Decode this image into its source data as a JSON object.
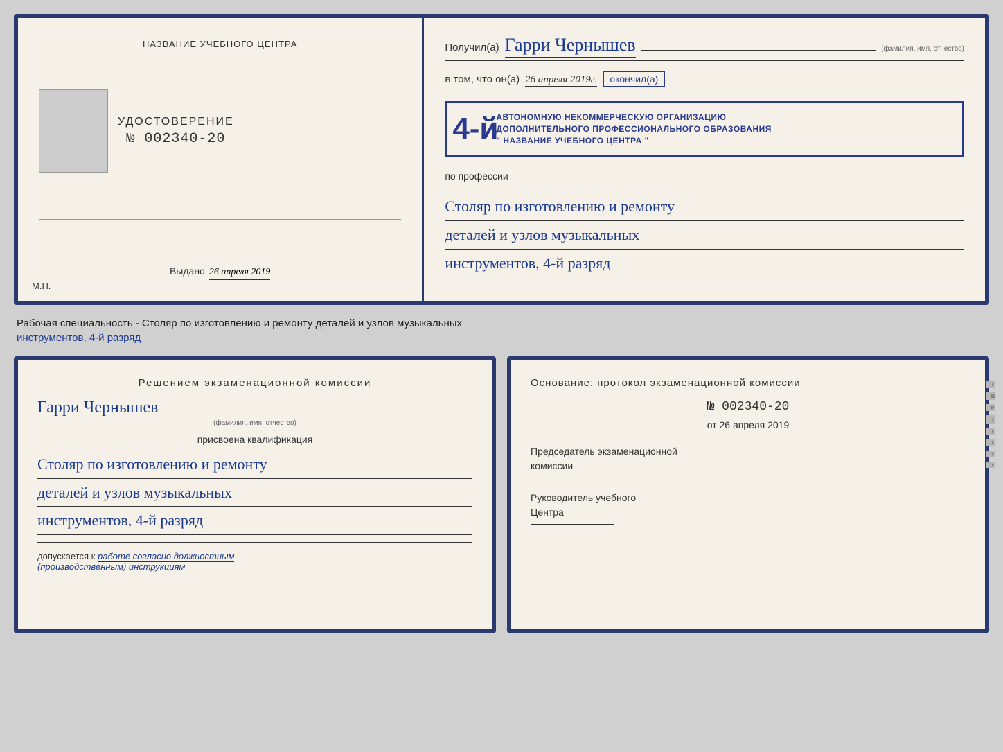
{
  "top_card": {
    "left": {
      "school_name": "НАЗВАНИЕ УЧЕБНОГО ЦЕНТРА",
      "cert_title": "УДОСТОВЕРЕНИЕ",
      "cert_number": "№ 002340-20",
      "issued_label": "Выдано",
      "issued_date": "26 апреля 2019",
      "mp_label": "М.П."
    },
    "right": {
      "received_label": "Получил(а)",
      "recipient_name": "Гарри Чернышев",
      "fio_label": "(фамилия, имя, отчество)",
      "vtom_label": "в том, что он(а)",
      "date_handwritten": "26 апреля 2019г.",
      "okoncil_label": "окончил(а)",
      "stamp_number": "4-й",
      "stamp_line1": "АВТОНОМНУЮ НЕКОММЕРЧЕСКУЮ ОРГАНИЗАЦИЮ",
      "stamp_line2": "ДОПОЛНИТЕЛЬНОГО ПРОФЕССИОНАЛЬНОГО ОБРАЗОВАНИЯ",
      "stamp_line3": "\" НАЗВАНИЕ УЧЕБНОГО ЦЕНТРА \"",
      "profession_label": "по профессии",
      "profession_line1": "Столяр по изготовлению и ремонту",
      "profession_line2": "деталей и узлов музыкальных",
      "profession_line3": "инструментов, 4-й разряд"
    }
  },
  "caption": {
    "text": "Рабочая специальность - Столяр по изготовлению и ремонту деталей и узлов музыкальных",
    "text2": "инструментов, 4-й разряд"
  },
  "bottom_left": {
    "decision_title": "Решением  экзаменационной  комиссии",
    "person_name": "Гарри Чернышев",
    "fio_label": "(фамилия, имя, отчество)",
    "assigned_text": "присвоена квалификация",
    "qualification_line1": "Столяр по изготовлению и ремонту",
    "qualification_line2": "деталей и узлов музыкальных",
    "qualification_line3": "инструментов, 4-й разряд",
    "admitted_prefix": "допускается к",
    "admitted_text": "работе согласно должностным",
    "admitted_text2": "(производственным) инструкциям"
  },
  "bottom_right": {
    "basis_label": "Основание: протокол экзаменационной  комиссии",
    "protocol_number": "№  002340-20",
    "from_prefix": "от",
    "from_date": "26 апреля 2019",
    "chairman_label": "Председатель экзаменационной",
    "chairman_label2": "комиссии",
    "head_label": "Руководитель учебного",
    "head_label2": "Центра"
  },
  "side_tabs": [
    "И",
    "а",
    "←",
    "–",
    "–",
    "–",
    "–"
  ],
  "side_tabs2": [
    "И",
    "а",
    "←",
    "–",
    "–",
    "–",
    "–"
  ]
}
